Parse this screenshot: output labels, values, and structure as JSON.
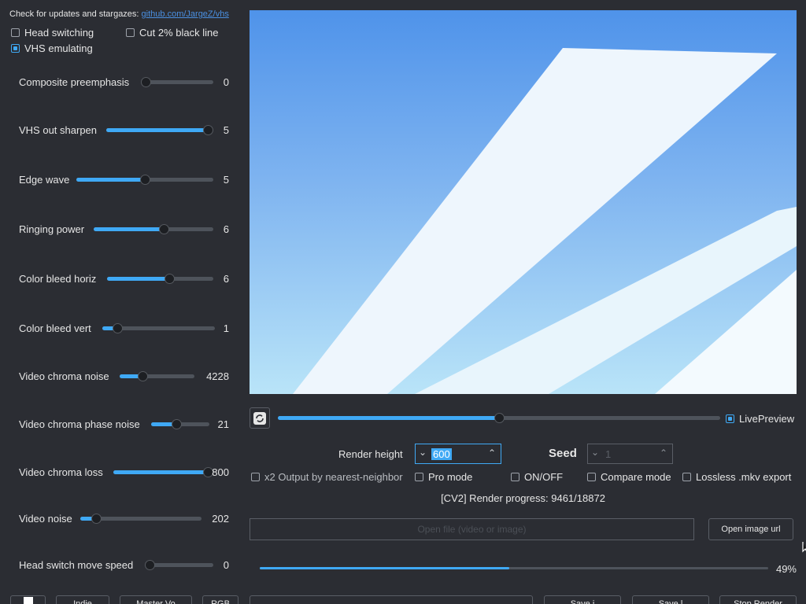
{
  "header": {
    "update_text": "Check for updates and stargazes:",
    "update_link": "github.com/JargeZ/vhs"
  },
  "options": {
    "head_switching": {
      "label": "Head switching",
      "checked": false
    },
    "cut_black_line": {
      "label": "Cut 2% black line",
      "checked": false
    },
    "vhs_emulating": {
      "label": "VHS emulating",
      "checked": true
    }
  },
  "sliders": [
    {
      "label": "Composite preemphasis",
      "value": "0",
      "level": 0.0
    },
    {
      "label": "VHS out sharpen",
      "value": "5",
      "level": 1.0
    },
    {
      "label": "Edge wave",
      "value": "5",
      "level": 0.5
    },
    {
      "label": "Ringing power",
      "value": "6",
      "level": 0.6
    },
    {
      "label": "Color bleed horiz",
      "value": "6",
      "level": 0.6
    },
    {
      "label": "Color bleed vert",
      "value": "1",
      "level": 0.1
    },
    {
      "label": "Video chroma noise",
      "value": "4228",
      "level": 0.28
    },
    {
      "label": "Video chroma phase noise",
      "value": "21",
      "level": 0.42
    },
    {
      "label": "Video chroma loss",
      "value": "800",
      "level": 1.0
    },
    {
      "label": "Video noise",
      "value": "202",
      "level": 0.1
    },
    {
      "label": "Head switch move speed",
      "value": "0",
      "level": 0.0
    }
  ],
  "timeline": {
    "level": 0.5
  },
  "live_preview": {
    "label": "LivePreview",
    "checked": true
  },
  "render_height": {
    "label": "Render height",
    "value": "600"
  },
  "seed": {
    "label": "Seed",
    "value": "1"
  },
  "flags": {
    "x2_output": {
      "label": "x2 Output by nearest-neighbor",
      "checked": false
    },
    "pro_mode": {
      "label": "Pro mode",
      "checked": false
    },
    "on_off": {
      "label": "ON/OFF",
      "checked": false
    },
    "compare_mode": {
      "label": "Compare mode",
      "checked": false
    },
    "lossless": {
      "label": "Lossless .mkv export",
      "checked": false
    }
  },
  "render_progress": "[CV2] Render progress: 9461/18872",
  "open_file_placeholder": "Open file (video or image)",
  "open_image_url_label": "Open image url",
  "progress": {
    "level": 0.49,
    "percent": "49%"
  },
  "bottom_bar": {
    "btn1": "",
    "btn2": "Indie",
    "btn3": "Master Vo",
    "btn4": "RGB",
    "btn5": "Save i",
    "btn6": "Save l",
    "btn7": "Stop Render"
  },
  "colors": {
    "accent": "#3fa9f5",
    "background": "#2b2d33"
  }
}
